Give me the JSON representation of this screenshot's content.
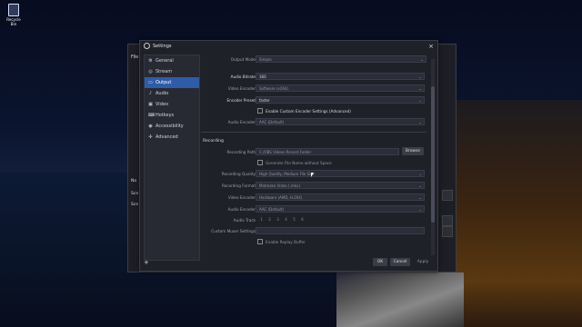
{
  "desktop": {
    "recycle_bin_label": "Recycle Bin"
  },
  "behind_window": {
    "menu_file": "File",
    "label_no": "No",
    "label_sce": "Sce",
    "label_sce2": "Sce"
  },
  "dialog": {
    "title": "Settings",
    "close": "×",
    "nav": [
      {
        "label": "General",
        "icon": "⚙"
      },
      {
        "label": "Stream",
        "icon": "◎"
      },
      {
        "label": "Output",
        "icon": "▭",
        "selected": true
      },
      {
        "label": "Audio",
        "icon": "♪"
      },
      {
        "label": "Video",
        "icon": "▣"
      },
      {
        "label": "Hotkeys",
        "icon": "⌨"
      },
      {
        "label": "Accessibility",
        "icon": "◉"
      },
      {
        "label": "Advanced",
        "icon": "✣"
      }
    ],
    "output": {
      "mode_label": "Output Mode",
      "mode_value": "Simple",
      "audio_bitrate_label": "Audio Bitrate",
      "audio_bitrate_value": "160",
      "video_encoder_label": "Video Encoder",
      "video_encoder_value": "Software (x264)",
      "encoder_preset_label": "Encoder Preset",
      "encoder_preset_value": "faster",
      "custom_encoder_label": "Enable Custom Encoder Settings (Advanced)",
      "audio_encoder_label": "Audio Encoder",
      "audio_encoder_value": "AAC (Default)"
    },
    "recording": {
      "section_title": "Recording",
      "path_label": "Recording Path",
      "path_value": "C:/OBS Videos Record Folder",
      "browse_label": "Browse",
      "gen_filename_label": "Generate File Name without Space",
      "quality_label": "Recording Quality",
      "quality_value": "High Quality, Medium File Size",
      "format_label": "Recording Format",
      "format_value": "Matroska Video (.mkv)",
      "video_encoder_label": "Video Encoder",
      "video_encoder_value": "Hardware (AMD, H.264)",
      "audio_encoder_label": "Audio Encoder",
      "audio_encoder_value": "AAC (Default)",
      "audio_track_label": "Audio Track",
      "tracks": [
        "1",
        "2",
        "3",
        "4",
        "5",
        "6"
      ],
      "muxer_label": "Custom Muxer Settings",
      "muxer_value": "",
      "replay_buffer_label": "Enable Replay Buffer"
    },
    "buttons": {
      "ok": "OK",
      "cancel": "Cancel",
      "apply": "Apply"
    },
    "add_icon": "+"
  },
  "colors": {
    "accent": "#2f5ca8",
    "dialog_bg": "#1f2129"
  }
}
